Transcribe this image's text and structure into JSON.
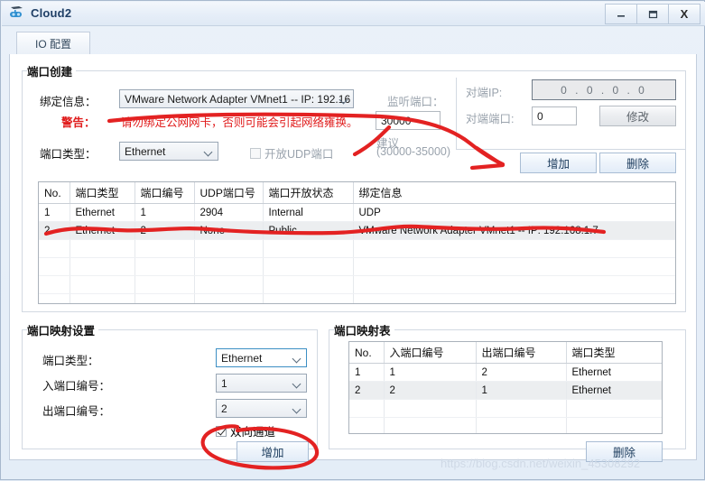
{
  "window": {
    "title": "Cloud2",
    "icon": "cloud-network-icon",
    "controls": {
      "minimize": "—",
      "maximize": "❐",
      "close": "X"
    }
  },
  "tabs": [
    {
      "label": "IO 配置",
      "active": true
    }
  ],
  "port_create": {
    "caption": "端口创建",
    "binding_label": "绑定信息：",
    "binding_value": "VMware Network Adapter VMnet1 -- IP: 192.16",
    "warning_label": "警告：",
    "warning_text": "请勿绑定公网网卡，否则可能会引起网络雍换。",
    "port_type_label": "端口类型：",
    "port_type_value": "Ethernet",
    "udp_checkbox_label": "开放UDP端口",
    "udp_checkbox_checked": false,
    "udp_checkbox_enabled": false,
    "listen_port_label": "监听端口：",
    "listen_port_value": "30000",
    "listen_port_hint_line1": "建议",
    "listen_port_hint_line2": "(30000-35000)",
    "peer_ip_label": "对端IP:",
    "peer_ip_value": "0 . 0 . 0 . 0",
    "peer_port_label": "对端端口:",
    "peer_port_value": "0",
    "modify_button": "修改",
    "add_button": "增加",
    "delete_button": "删除"
  },
  "port_table": {
    "columns": [
      "No.",
      "端口类型",
      "端口编号",
      "UDP端口号",
      "端口开放状态",
      "绑定信息"
    ],
    "rows": [
      {
        "cells": [
          "1",
          "Ethernet",
          "1",
          "2904",
          "Internal",
          "UDP"
        ],
        "selected": false
      },
      {
        "cells": [
          "2",
          "Ethernet",
          "2",
          "None",
          "Public",
          "VMware Network Adapter VMnet1 -- IP: 192.168.1.7"
        ],
        "selected": true
      }
    ],
    "empty_rows": 6
  },
  "mapping_settings": {
    "caption": "端口映射设置",
    "port_type_label": "端口类型：",
    "port_type_value": "Ethernet",
    "in_port_label": "入端口编号：",
    "in_port_value": "1",
    "out_port_label": "出端口编号：",
    "out_port_value": "2",
    "bidirectional_label": "双向通道",
    "bidirectional_checked": true,
    "add_button": "增加"
  },
  "mapping_table": {
    "caption": "端口映射表",
    "columns": [
      "No.",
      "入端口编号",
      "出端口编号",
      "端口类型"
    ],
    "rows": [
      {
        "cells": [
          "1",
          "1",
          "2",
          "Ethernet"
        ],
        "selected": false
      },
      {
        "cells": [
          "2",
          "2",
          "1",
          "Ethernet"
        ],
        "selected": true
      }
    ],
    "empty_rows": 3,
    "delete_button": "删除"
  },
  "watermark": "https://blog.csdn.net/weixin_45308292",
  "colors": {
    "accent": "#1f3f66",
    "warning": "#e01b1b",
    "annotation": "#e32222",
    "selected_row": "#eceef0"
  }
}
